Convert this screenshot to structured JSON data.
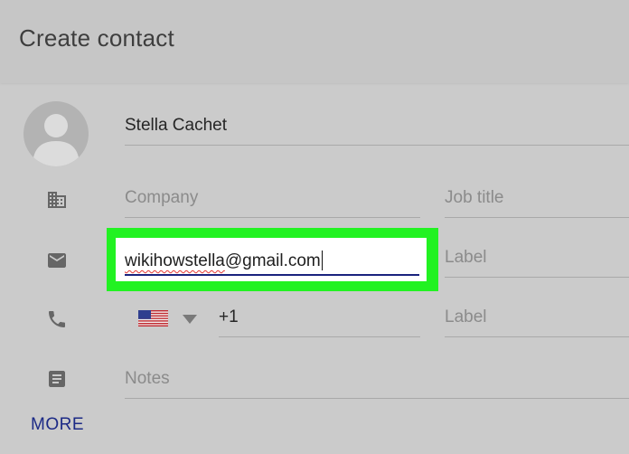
{
  "header": {
    "title": "Create contact"
  },
  "contact": {
    "name": "Stella Cachet",
    "company_placeholder": "Company",
    "job_title_placeholder": "Job title",
    "email_value": "wikihowstella@gmail.com",
    "email_misspelled_part": "wikihowstella",
    "email_rest": "@gmail.com",
    "email_label_placeholder": "Label",
    "phone_country_code": "+1",
    "phone_label_placeholder": "Label",
    "notes_placeholder": "Notes"
  },
  "footer": {
    "more_label": "MORE"
  },
  "colors": {
    "highlight": "#22f222",
    "more_link": "#1c2a86",
    "email_underline": "#1a237e",
    "background": "#cbcbcb"
  },
  "icons": {
    "avatar": "person-avatar-icon",
    "company": "building-icon",
    "email": "envelope-icon",
    "phone": "phone-icon",
    "notes": "notes-icon",
    "country": "us-flag-icon",
    "dropdown": "dropdown-arrow-icon"
  }
}
